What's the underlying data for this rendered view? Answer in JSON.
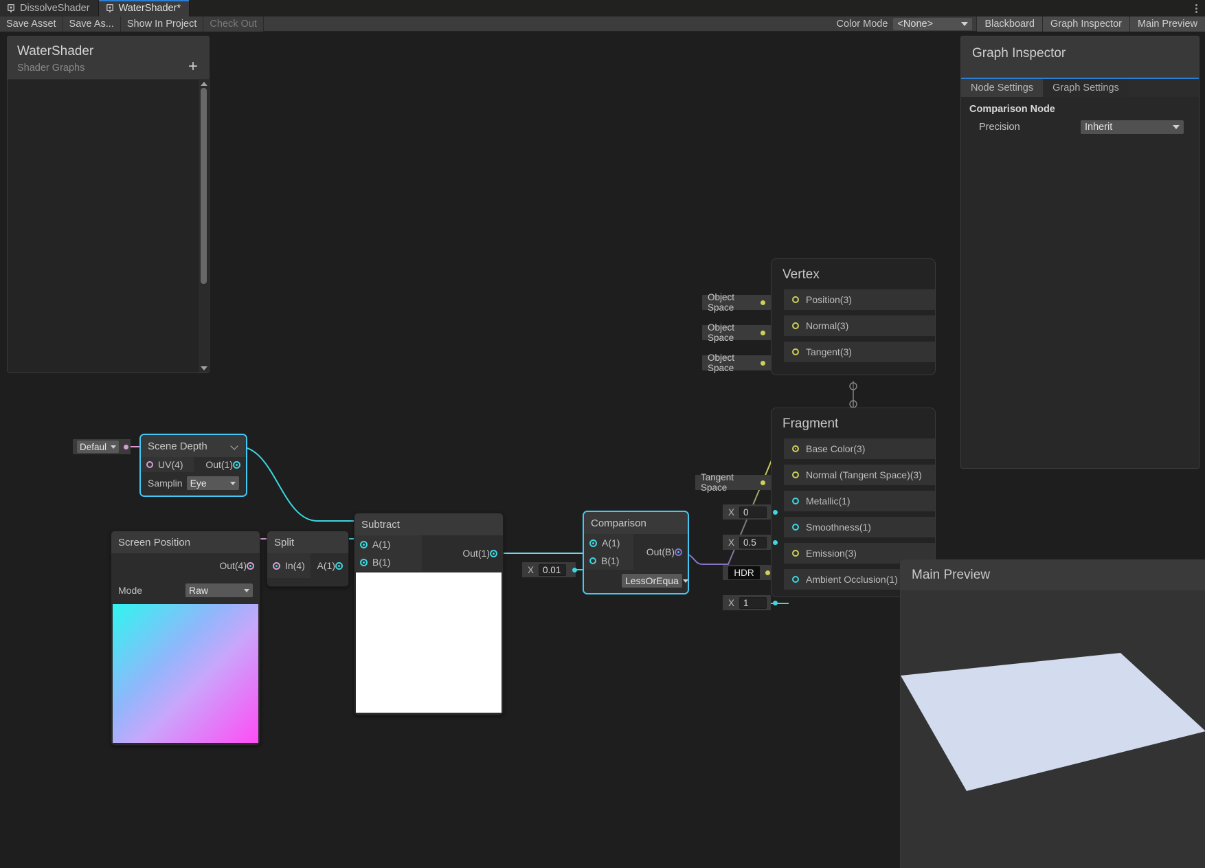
{
  "window": {
    "tabs": [
      {
        "label": "DissolveShader",
        "icon": "shader-graph-icon",
        "active": false
      },
      {
        "label": "WaterShader*",
        "icon": "shader-graph-icon",
        "active": true
      }
    ],
    "menu_icon": "kebab-menu-icon"
  },
  "toolbar": {
    "save_asset": "Save Asset",
    "save_as": "Save As...",
    "show_in_project": "Show In Project",
    "check_out": "Check Out",
    "color_mode_label": "Color Mode",
    "color_mode_value": "<None>",
    "blackboard": "Blackboard",
    "graph_inspector": "Graph Inspector",
    "main_preview": "Main Preview"
  },
  "blackboard": {
    "title": "WaterShader",
    "subtitle": "Shader Graphs",
    "add_icon": "plus-icon",
    "scroll_up_icon": "caret-up-icon",
    "scroll_down_icon": "caret-down-icon"
  },
  "inspector": {
    "title": "Graph Inspector",
    "tabs": [
      {
        "label": "Node Settings",
        "active": true
      },
      {
        "label": "Graph Settings",
        "active": false
      }
    ],
    "section": "Comparison Node",
    "precision_label": "Precision",
    "precision_value": "Inherit"
  },
  "nodes": {
    "scene_depth": {
      "title": "Scene Depth",
      "collapse_icon": "chevron-down-icon",
      "in_port": "UV(4)",
      "out_port": "Out(1)",
      "control_label": "Samplin",
      "control_value": "Eye",
      "uv_chip": "Defaul"
    },
    "screen_position": {
      "title": "Screen Position",
      "out_port": "Out(4)",
      "control_label": "Mode",
      "control_value": "Raw"
    },
    "split": {
      "title": "Split",
      "in_port": "In(4)",
      "out_ports": [
        "A(1)"
      ]
    },
    "subtract": {
      "title": "Subtract",
      "in_ports": [
        "A(1)",
        "B(1)"
      ],
      "out_port": "Out(1)"
    },
    "comparison": {
      "title": "Comparison",
      "in_ports": [
        "A(1)",
        "B(1)"
      ],
      "out_port": "Out(B)",
      "b_chip_label": "X",
      "b_chip_value": "0.01",
      "mode_value": "LessOrEqua"
    }
  },
  "vertex_block": {
    "title": "Vertex",
    "rows": [
      {
        "label": "Position(3)",
        "chip": "Object Space",
        "chip_type": "space"
      },
      {
        "label": "Normal(3)",
        "chip": "Object Space",
        "chip_type": "space"
      },
      {
        "label": "Tangent(3)",
        "chip": "Object Space",
        "chip_type": "space"
      }
    ]
  },
  "fragment_block": {
    "title": "Fragment",
    "rows": [
      {
        "label": "Base Color(3)",
        "chip": "",
        "chip_type": "none"
      },
      {
        "label": "Normal (Tangent Space)(3)",
        "chip": "Tangent Space",
        "chip_type": "space"
      },
      {
        "label": "Metallic(1)",
        "chip": "0",
        "chip_type": "x"
      },
      {
        "label": "Smoothness(1)",
        "chip": "0.5",
        "chip_type": "x"
      },
      {
        "label": "Emission(3)",
        "chip": "HDR",
        "chip_type": "hdr"
      },
      {
        "label": "Ambient Occlusion(1)",
        "chip": "1",
        "chip_type": "x"
      }
    ],
    "x_label": "X"
  },
  "main_preview": {
    "title": "Main Preview"
  },
  "colors": {
    "accent_blue": "#2c7fd4",
    "wire_cyan": "#3ed6e0",
    "wire_pink": "#d79cd0",
    "wire_yellow": "#cfd05a",
    "wire_purple": "#8b6fd8",
    "selection": "#44c8f5",
    "preview_surface": "#d3dcef"
  }
}
